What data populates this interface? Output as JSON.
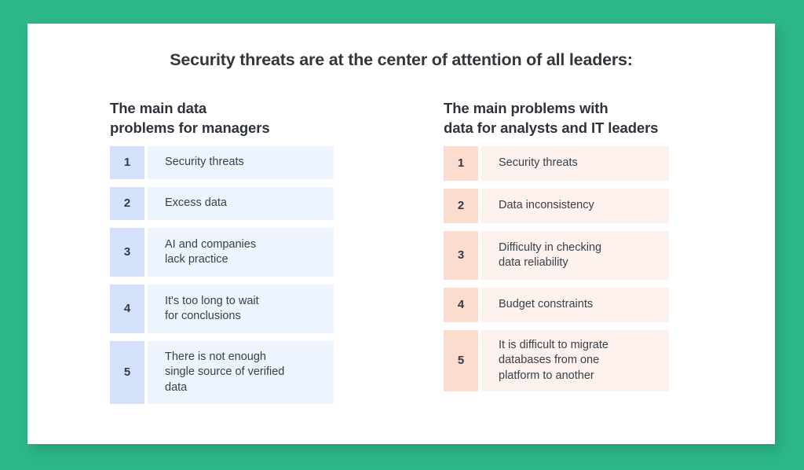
{
  "theme": {
    "page_background": "#2bb789",
    "card_background": "#ffffff",
    "title_color": "#33363d",
    "heading_color": "#2f333b",
    "body_text_color": "#3a4048",
    "left_accent": "#d3e1fb",
    "left_body": "#eef4fe",
    "right_accent": "#fbdccd",
    "right_body": "#fdf2ee"
  },
  "title": "Security threats are at the center of attention of all leaders:",
  "columns": [
    {
      "heading": "The main data\nproblems for managers",
      "items": [
        {
          "number": "1",
          "text": "Security threats",
          "lines": 1
        },
        {
          "number": "2",
          "text": "Excess data",
          "lines": 1
        },
        {
          "number": "3",
          "text": "AI and companies\nlack practice",
          "lines": 2
        },
        {
          "number": "4",
          "text": "It's too long to wait\nfor conclusions",
          "lines": 2
        },
        {
          "number": "5",
          "text": "There is not enough\nsingle source of verified\ndata",
          "lines": 3
        }
      ]
    },
    {
      "heading": "The main problems with\ndata for analysts and IT leaders",
      "items": [
        {
          "number": "1",
          "text": "Security threats",
          "lines": 1
        },
        {
          "number": "2",
          "text": "Data inconsistency",
          "lines": 1
        },
        {
          "number": "3",
          "text": "Difficulty in checking\ndata reliability",
          "lines": 2
        },
        {
          "number": "4",
          "text": "Budget constraints",
          "lines": 1
        },
        {
          "number": "5",
          "text": "It is difficult to migrate\ndatabases from one\nplatform to another",
          "lines": 3
        }
      ]
    }
  ]
}
